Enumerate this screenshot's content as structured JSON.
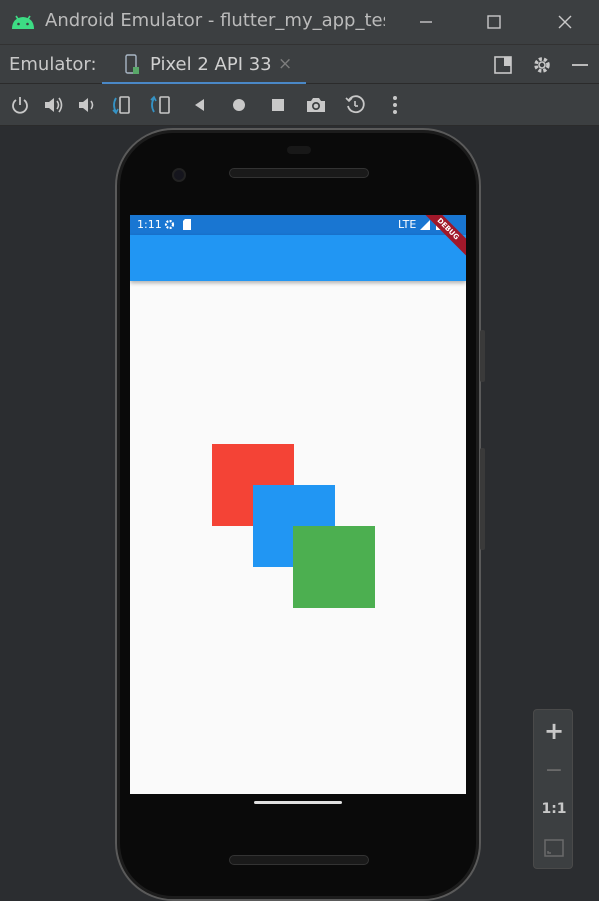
{
  "window": {
    "title": "Android Emulator - flutter_my_app_test",
    "minimize_icon": "minimize-icon",
    "maximize_icon": "maximize-icon",
    "close_icon": "close-icon"
  },
  "tabbar": {
    "label": "Emulator:",
    "tab_name": "Pixel 2 API 33",
    "close_glyph": "×"
  },
  "toolbar": {
    "icons": [
      "power-icon",
      "volume-up-icon",
      "volume-down-icon",
      "rotate-left-icon",
      "rotate-right-icon",
      "back-icon",
      "home-icon",
      "overview-icon",
      "screenshot-icon",
      "snapshot-icon",
      "more-icon"
    ]
  },
  "statusbar": {
    "time": "1:11",
    "network": "LTE"
  },
  "debug_banner": "DEBUG",
  "squares": [
    {
      "name": "red",
      "color": "#f44336"
    },
    {
      "name": "blue",
      "color": "#2196f3"
    },
    {
      "name": "green",
      "color": "#4caf50"
    }
  ],
  "zoom": {
    "zoom_in": "+",
    "zoom_out": "−",
    "actual_size": "1:1"
  },
  "colors": {
    "accent": "#4a88c7",
    "app_bar": "#2196f3",
    "status_bar": "#1976d2"
  }
}
